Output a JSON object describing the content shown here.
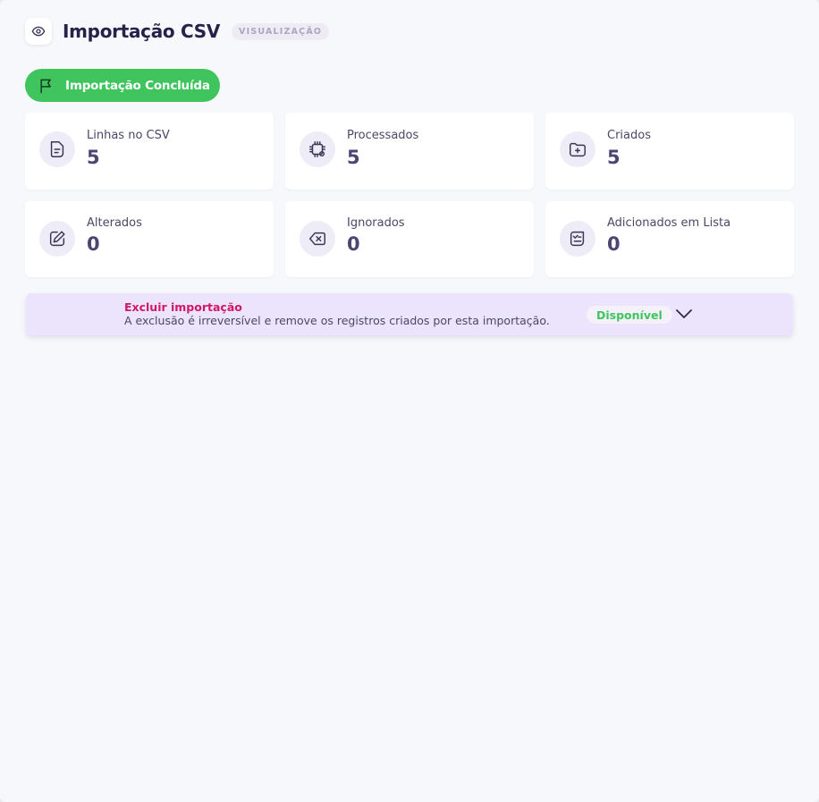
{
  "header": {
    "title": "Importação CSV",
    "mode_badge": "VISUALIZAÇÃO",
    "icon": "eye-icon"
  },
  "status": {
    "label": "Importação Concluída",
    "icon": "flag-icon",
    "color": "#3fc45e"
  },
  "stats": [
    {
      "label": "Linhas no CSV",
      "value": "5",
      "icon": "file-text-icon"
    },
    {
      "label": "Processados",
      "value": "5",
      "icon": "cpu-gear-icon"
    },
    {
      "label": "Criados",
      "value": "5",
      "icon": "folder-plus-icon"
    },
    {
      "label": "Alterados",
      "value": "0",
      "icon": "edit-icon"
    },
    {
      "label": "Ignorados",
      "value": "0",
      "icon": "backspace-x-icon"
    },
    {
      "label": "Adicionados em Lista",
      "value": "0",
      "icon": "list-check-icon"
    }
  ],
  "delete_section": {
    "title": "Excluir importação",
    "description": "A exclusão é irreversível e remove os registros criados por esta importação.",
    "badge": "Disponível",
    "title_color": "#d01966",
    "icon": "chevron-down-icon"
  }
}
